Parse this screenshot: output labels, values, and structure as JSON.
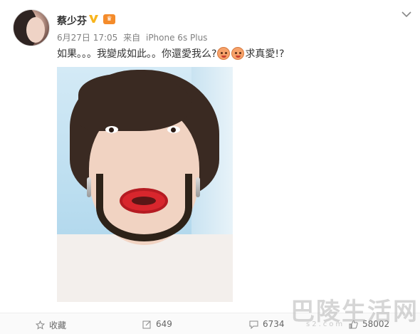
{
  "post": {
    "username": "蔡少芬",
    "vip_badge": "👑",
    "date": "6月27日 17:05",
    "source_prefix": "来自",
    "source": "iPhone 6s Plus",
    "text_part1": "如果。。。我變成如此。。你還愛我么?",
    "text_part2": "求真愛!?",
    "emoji_names": [
      "doge-face-icon",
      "doge-face-icon"
    ]
  },
  "actions": {
    "favorite_label": "收藏",
    "repost_count": "649",
    "comment_count": "6734",
    "like_count": "58002"
  },
  "watermark": {
    "text": "巴陵生活网",
    "url": "s2.com"
  },
  "colors": {
    "verified": "#f8b51d",
    "vip": "#f48b2a",
    "text": "#333333",
    "meta": "#808080"
  }
}
